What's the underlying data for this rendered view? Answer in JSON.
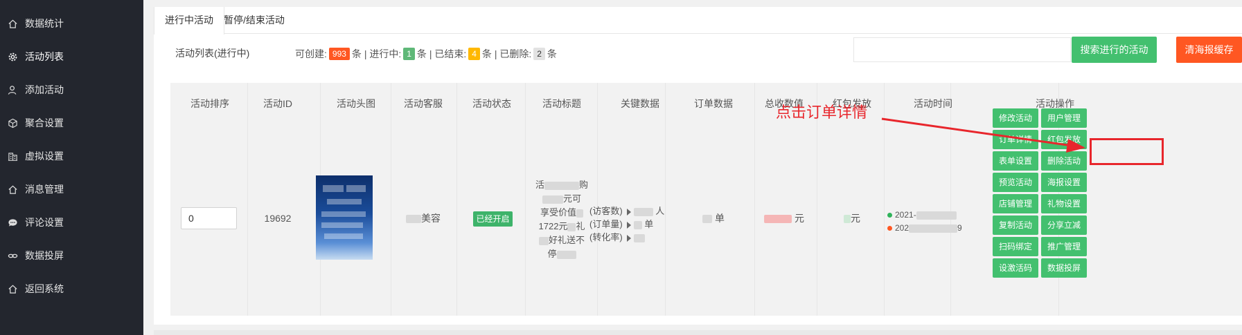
{
  "sidebar": {
    "items": [
      {
        "label": "数据统计",
        "icon": "home-icon"
      },
      {
        "label": "活动列表",
        "icon": "gear-icon"
      },
      {
        "label": "添加活动",
        "icon": "user-icon"
      },
      {
        "label": "聚合设置",
        "icon": "cube-icon"
      },
      {
        "label": "虚拟设置",
        "icon": "building-icon"
      },
      {
        "label": "消息管理",
        "icon": "home-icon"
      },
      {
        "label": "评论设置",
        "icon": "chat-icon"
      },
      {
        "label": "数据投屏",
        "icon": "link-icon"
      },
      {
        "label": "返回系统",
        "icon": "home-icon"
      }
    ]
  },
  "tabs": [
    "进行中活动",
    "暂停/结束活动"
  ],
  "stats": {
    "list_label": "活动列表(进行中)",
    "can_create": "可创建:",
    "can_create_count": "993",
    "unit": "条",
    "sep": "|",
    "ongoing": "进行中:",
    "ongoing_count": "1",
    "ended": "已结束:",
    "ended_count": "4",
    "deleted": "已删除:",
    "deleted_count": "2"
  },
  "search": {
    "value": "",
    "button": "搜索进行的活动"
  },
  "clear_cache_button": "清海报缓存",
  "table": {
    "headers": [
      "活动排序",
      "活动ID",
      "活动头图",
      "活动客服",
      "活动状态",
      "活动标题",
      "关键数据",
      "订单数据",
      "总收数值",
      "红包发放",
      "活动时间",
      "活动操作"
    ],
    "row": {
      "sort_value": "0",
      "activity_id": "19692",
      "service": "美容",
      "status": "已经开启",
      "title_lines": [
        "活",
        "购",
        "元可",
        "享受价值",
        "1722元",
        "礼",
        "好礼送不",
        "停"
      ],
      "key_data": {
        "visitors_label": "(访客数)",
        "visitors_unit": "人",
        "orders_label": "(订单量)",
        "orders_unit": "单",
        "conversion_label": "(转化率)"
      },
      "order_unit": "单",
      "revenue_unit": "元",
      "redpacket_unit": "元",
      "time_start": "2021-",
      "time_end": "202",
      "time_end_tail": "9"
    },
    "operations": [
      [
        "修改活动",
        "用户管理"
      ],
      [
        "订单详情",
        "红包发放"
      ],
      [
        "表单设置",
        "删除活动"
      ],
      [
        "预览活动",
        "海报设置"
      ],
      [
        "店铺管理",
        "礼物设置"
      ],
      [
        "复制活动",
        "分享立减"
      ],
      [
        "扫码绑定",
        "推广管理"
      ],
      [
        "设激活码",
        "数据投屏"
      ]
    ]
  },
  "annotation": {
    "text": "点击订单详情"
  },
  "colors": {
    "sidebar_bg": "#23262e",
    "primary_green": "#43c06f",
    "danger": "#ff5722",
    "annotation_red": "#e8262c"
  }
}
